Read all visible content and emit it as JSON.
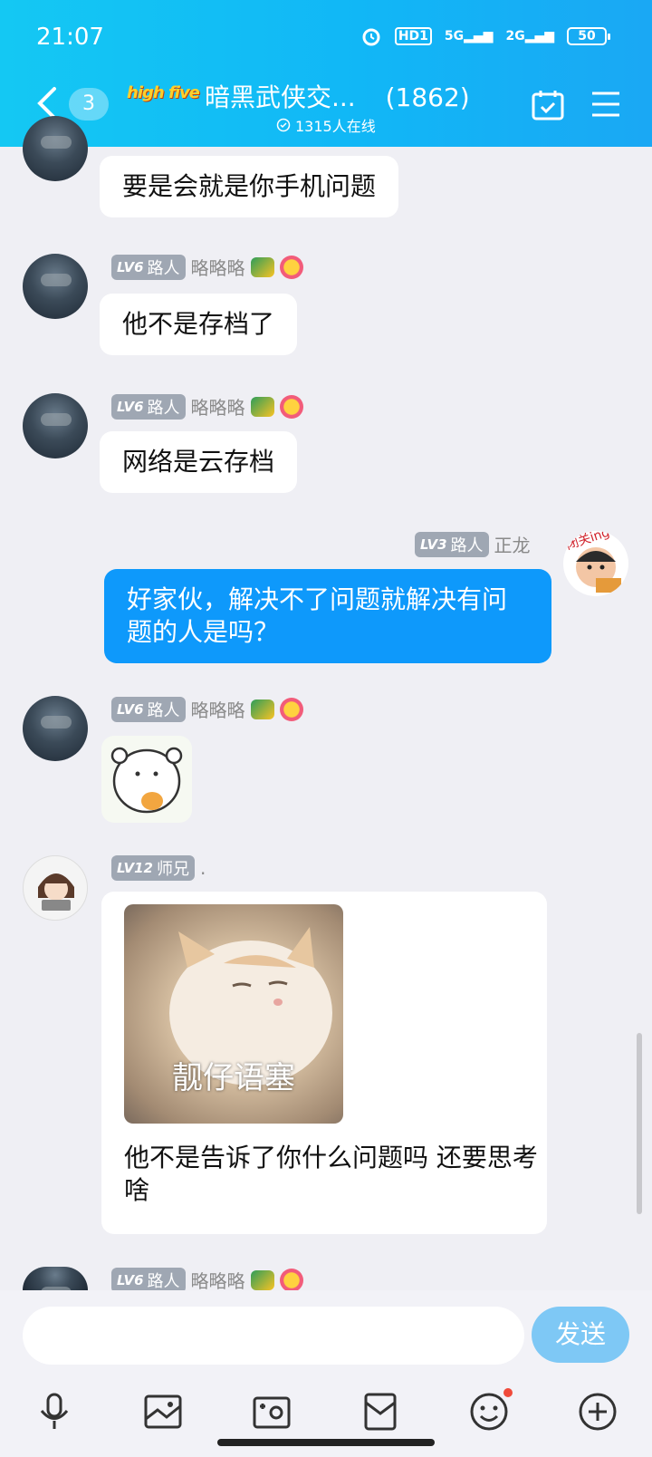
{
  "status_bar": {
    "time": "21:07",
    "hd": "HD1",
    "net1": "5G",
    "net2": "2G",
    "battery": "50"
  },
  "header": {
    "back_count": "3",
    "logo": "high five",
    "title": "暗黑武侠交...",
    "member_count": "(1862)",
    "online": "1315人在线"
  },
  "messages": [
    {
      "text": "要是会就是你手机问题"
    },
    {
      "level": "LV6",
      "role": "路人",
      "name": "略略略",
      "text": "他不是存档了"
    },
    {
      "level": "LV6",
      "role": "路人",
      "name": "略略略",
      "text": "网络是云存档"
    },
    {
      "level": "LV3",
      "role": "路人",
      "name": "正龙",
      "text": "好家伙，解决不了问题就解决有问题的人是吗？",
      "avatar_tag": "闭关ing"
    },
    {
      "level": "LV6",
      "role": "路人",
      "name": "略略略"
    },
    {
      "level": "LV12",
      "role": "师兄",
      "name": ".",
      "image_caption": "靓仔语塞",
      "text": "他不是告诉了你什么问题吗  还要思考啥"
    },
    {
      "level": "LV6",
      "role": "路人",
      "name": "略略略"
    }
  ],
  "input": {
    "placeholder": "",
    "send_label": "发送"
  },
  "toolbar_icons": [
    "mic-icon",
    "image-icon",
    "camera-icon",
    "red-packet-icon",
    "emoji-icon",
    "plus-icon"
  ]
}
